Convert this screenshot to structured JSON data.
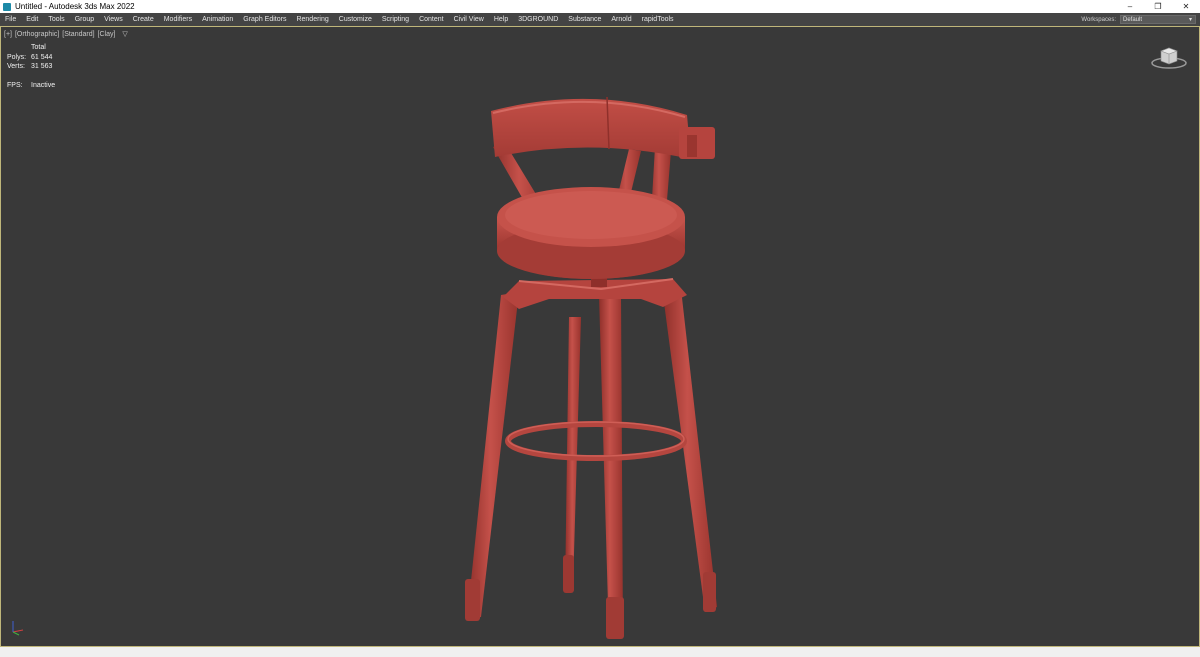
{
  "titlebar": {
    "title": "Untitled - Autodesk 3ds Max 2022",
    "minimize": "–",
    "restore": "❐",
    "close": "✕"
  },
  "menubar": {
    "items": [
      "File",
      "Edit",
      "Tools",
      "Group",
      "Views",
      "Create",
      "Modifiers",
      "Animation",
      "Graph Editors",
      "Rendering",
      "Customize",
      "Scripting",
      "Content",
      "Civil View",
      "Help",
      "3DGROUND",
      "Substance",
      "Arnold",
      "rapidTools"
    ],
    "workspaces_label": "Workspaces:",
    "workspaces_value": "Default"
  },
  "viewport": {
    "label_plus": "[+]",
    "label_view": "[Orthographic]",
    "label_shading": "[Standard]",
    "label_style": "[Clay]",
    "filter_icon": "funnel-icon",
    "stats": {
      "header": "Total",
      "polys_label": "Polys:",
      "polys_value": "61 544",
      "verts_label": "Verts:",
      "verts_value": "31 563",
      "fps_label": "FPS:",
      "fps_value": "Inactive"
    },
    "colors": {
      "background": "#393939",
      "model": "#b8463f",
      "border": "#bfb67a"
    }
  }
}
